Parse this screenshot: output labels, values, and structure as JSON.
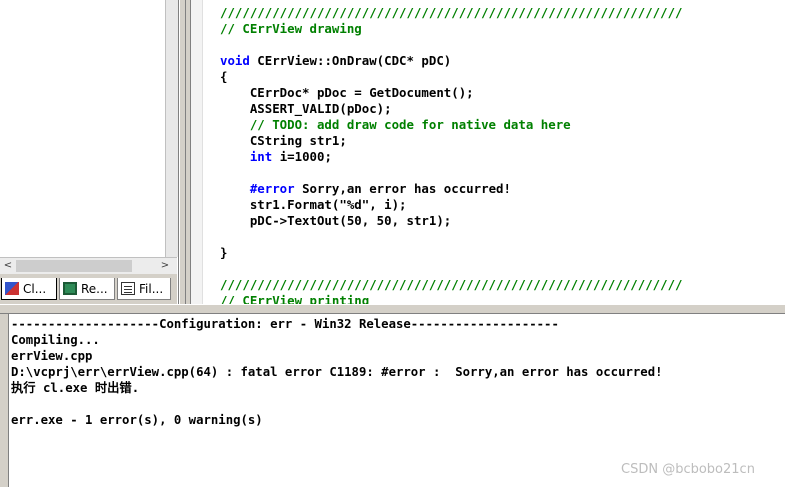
{
  "workspace": {
    "tabs": [
      {
        "label": "Cl...",
        "icon": "class-view-icon"
      },
      {
        "label": "Re...",
        "icon": "resource-view-icon"
      },
      {
        "label": "Fil...",
        "icon": "file-view-icon"
      }
    ]
  },
  "editor": {
    "lines": [
      {
        "text": "//////////////////////////////////////////////////////////////",
        "type": "comment"
      },
      {
        "text": "// CErrView drawing",
        "type": "comment"
      },
      {
        "text": "",
        "type": "code"
      },
      {
        "text": "void CErrView::OnDraw(CDC* pDC)",
        "type": "code",
        "keyword": "void",
        "rest": " CErrView::OnDraw(CDC* pDC)"
      },
      {
        "text": "{",
        "type": "code"
      },
      {
        "text": "    CErrDoc* pDoc = GetDocument();",
        "type": "code"
      },
      {
        "text": "    ASSERT_VALID(pDoc);",
        "type": "code"
      },
      {
        "text": "    // TODO: add draw code for native data here",
        "type": "comment"
      },
      {
        "text": "    CString str1;",
        "type": "code"
      },
      {
        "text": "    int i=1000;",
        "type": "code",
        "indent": "    ",
        "keyword": "int",
        "rest": " i=1000;"
      },
      {
        "text": "",
        "type": "code"
      },
      {
        "text": "    #error Sorry,an error has occurred!",
        "type": "code",
        "indent": "    ",
        "keyword": "#error",
        "rest": " Sorry,an error has occurred!"
      },
      {
        "text": "    str1.Format(\"%d\", i);",
        "type": "code"
      },
      {
        "text": "    pDC->TextOut(50, 50, str1);",
        "type": "code"
      },
      {
        "text": "",
        "type": "code"
      },
      {
        "text": "}",
        "type": "code"
      },
      {
        "text": "",
        "type": "code"
      },
      {
        "text": "//////////////////////////////////////////////////////////////",
        "type": "comment"
      },
      {
        "text": "// CErrView printing",
        "type": "comment"
      }
    ]
  },
  "output": {
    "lines": [
      "--------------------Configuration: err - Win32 Release--------------------",
      "Compiling...",
      "errView.cpp",
      "D:\\vcprj\\err\\errView.cpp(64) : fatal error C1189: #error :  Sorry,an error has occurred!",
      "执行 cl.exe 时出错.",
      "",
      "err.exe - 1 error(s), 0 warning(s)"
    ]
  },
  "watermark": "CSDN @bcbobo21cn",
  "colors": {
    "comment": "#008000",
    "keyword": "#0000ff",
    "panel": "#d4d0c8"
  }
}
